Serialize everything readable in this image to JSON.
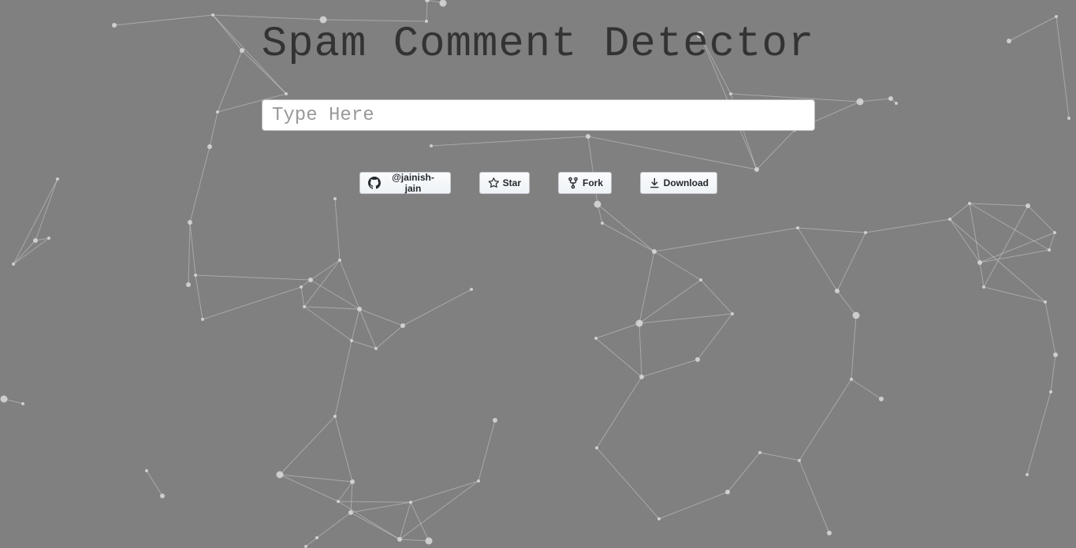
{
  "header": {
    "title": "Spam Comment Detector"
  },
  "comment_input": {
    "placeholder": "Type Here",
    "value": ""
  },
  "github_buttons": {
    "profile_label": "@jainish-jain",
    "star_label": "Star",
    "fork_label": "Fork",
    "download_label": "Download"
  },
  "icons": {
    "profile": "github-mark-icon",
    "star": "star-icon",
    "fork": "fork-icon",
    "download": "download-icon"
  },
  "colors": {
    "background": "#808080",
    "title": "#333333",
    "particle": "#d9d9d9"
  }
}
